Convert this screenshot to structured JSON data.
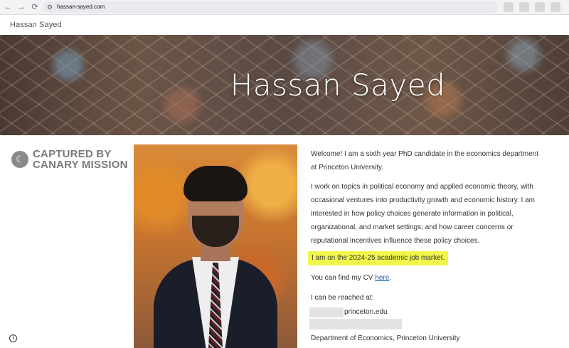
{
  "browser": {
    "url": "hassan-sayed.com",
    "back_glyph": "←",
    "forward_glyph": "→",
    "reload_glyph": "⟳",
    "site_info_glyph": "⚙"
  },
  "site": {
    "title": "Hassan Sayed"
  },
  "hero": {
    "title": "Hassan Sayed"
  },
  "badge": {
    "line1": "CAPTURED BY",
    "line2": "CANARY MISSION",
    "icon_glyph": "☾"
  },
  "content": {
    "welcome": "Welcome! I am a sixth year PhD candidate in the economics department at Princeton University.",
    "research": "I work on topics in political economy and applied economic theory, with occasional ventures into productivity growth and economic history. I am interested in how policy choices generate information in political, organizational, and market settings; and how career concerns or reputational incentives influence these policy choices.",
    "job_market": "I am on the 2024-25 academic job market.",
    "cv_prefix": "You can find my CV ",
    "cv_link": "here",
    "cv_suffix": ".",
    "reach_label": "I can be reached at:",
    "email_suffix": "princeton.edu",
    "department": "Department of Economics, Princeton University"
  },
  "footer": {
    "info_glyph": "i"
  },
  "colors": {
    "highlight": "#f1f74a",
    "link": "#1a5fb4"
  }
}
